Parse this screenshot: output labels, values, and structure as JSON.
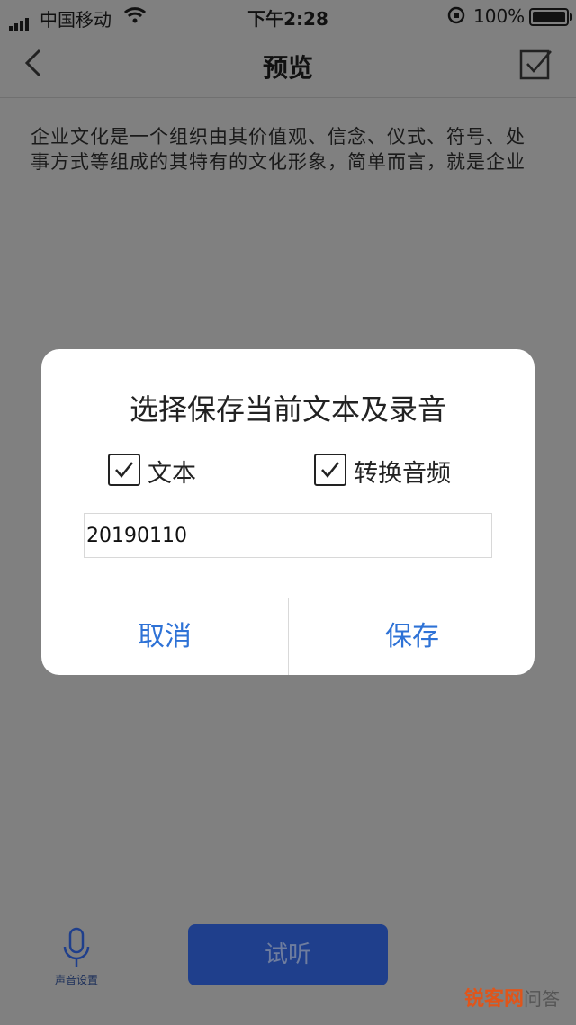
{
  "status": {
    "carrier": "中国移动",
    "time": "下午2:28",
    "battery_pct": "100%"
  },
  "nav": {
    "title": "预览"
  },
  "content": {
    "line1": "企业文化是一个组织由其价值观、信念、仪式、符号、处",
    "line2": "事方式等组成的其特有的文化形象，简单而言，就是企业"
  },
  "dialog": {
    "title": "选择保存当前文本及录音",
    "options": [
      {
        "label": "文本",
        "checked": true
      },
      {
        "label": "转换音频",
        "checked": true
      }
    ],
    "filename_value": "20190110",
    "cancel_label": "取消",
    "save_label": "保存"
  },
  "bottom": {
    "voice_label": "声音设置",
    "listen_label": "试听"
  },
  "watermark": {
    "brand": "锐客网",
    "sub": "问答"
  },
  "colors": {
    "overlay": "#808080",
    "accent_blue": "#2e72d6",
    "button_blue": "#1f3f8c"
  },
  "icons": [
    "back-chevron-icon",
    "checkbox-confirm-icon",
    "microphone-icon",
    "wifi-icon",
    "signal-icon",
    "battery-icon",
    "rotation-lock-icon"
  ]
}
